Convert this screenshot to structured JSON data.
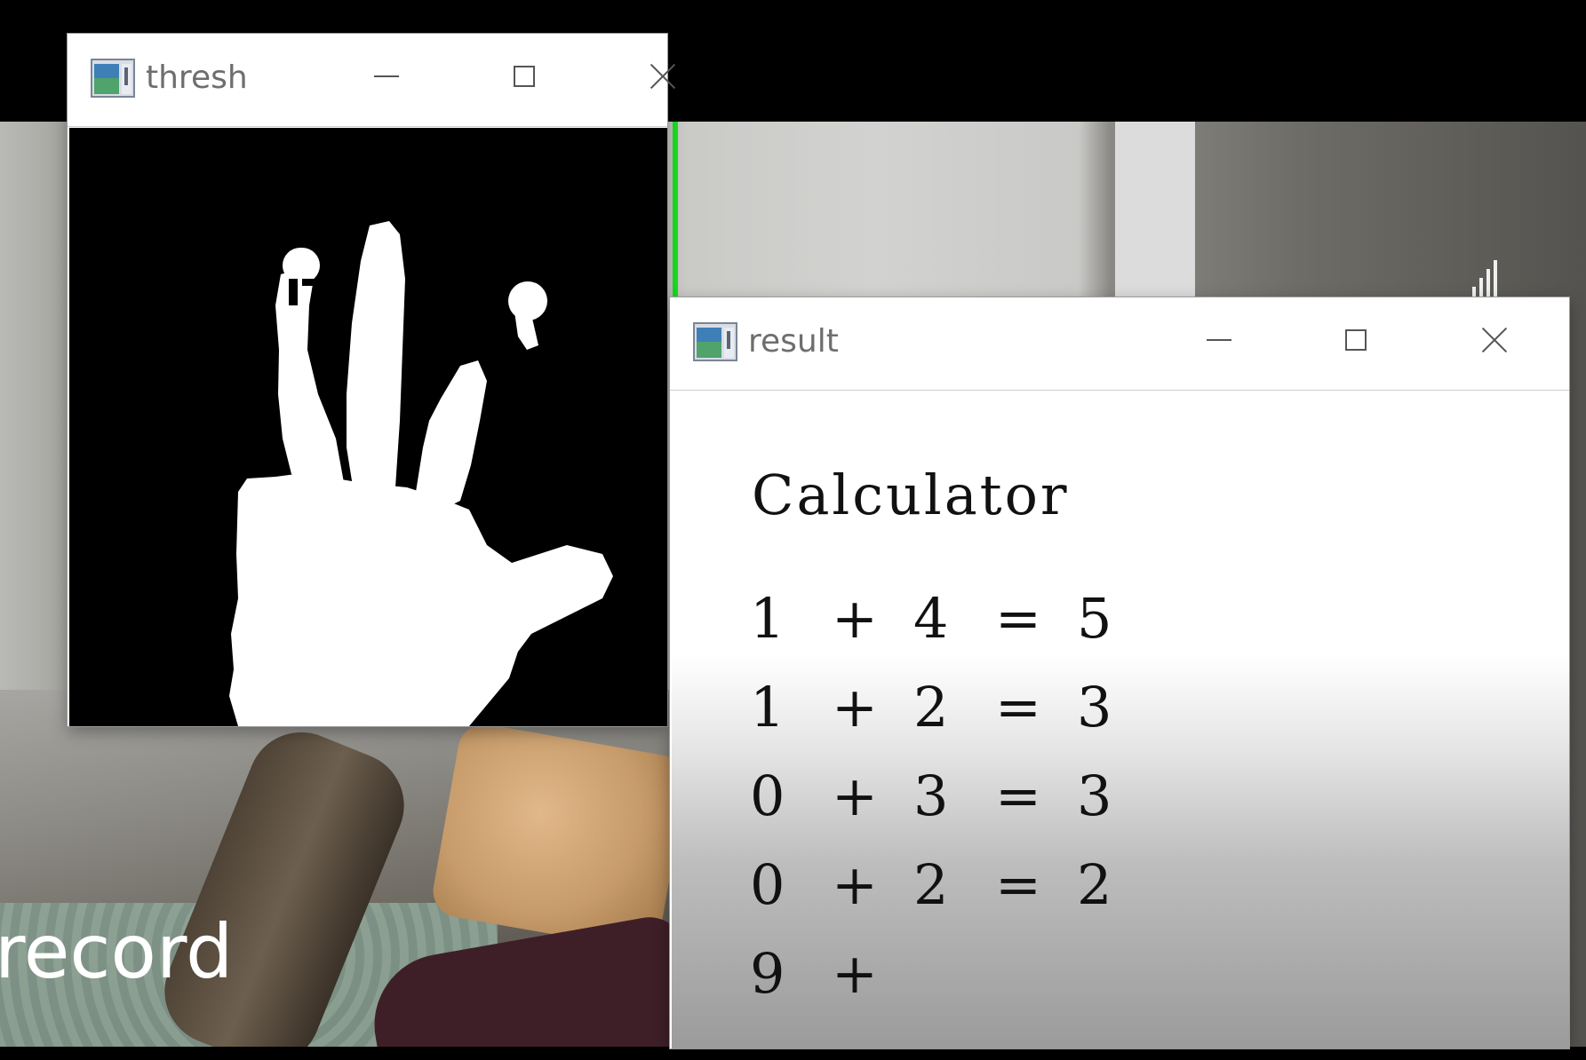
{
  "background": {
    "overlay_text": "record",
    "accent_line_color": "#18e51e"
  },
  "thresh_window": {
    "title": "thresh",
    "icon": "opencv-window-icon",
    "controls": [
      "minimize-icon",
      "maximize-icon",
      "close-icon"
    ]
  },
  "result_window": {
    "title": "result",
    "icon": "opencv-window-icon",
    "controls": [
      "minimize-icon",
      "maximize-icon",
      "close-icon"
    ],
    "heading": "Calculator",
    "equations": [
      {
        "a": "1",
        "op": "+",
        "b": "4",
        "eq": "=",
        "result": "5"
      },
      {
        "a": "1",
        "op": "+",
        "b": "2",
        "eq": "=",
        "result": "3"
      },
      {
        "a": "0",
        "op": "+",
        "b": "3",
        "eq": "=",
        "result": "3"
      },
      {
        "a": "0",
        "op": "+",
        "b": "2",
        "eq": "=",
        "result": "2"
      },
      {
        "a": "9",
        "op": "+",
        "b": "",
        "eq": "",
        "result": ""
      }
    ]
  }
}
